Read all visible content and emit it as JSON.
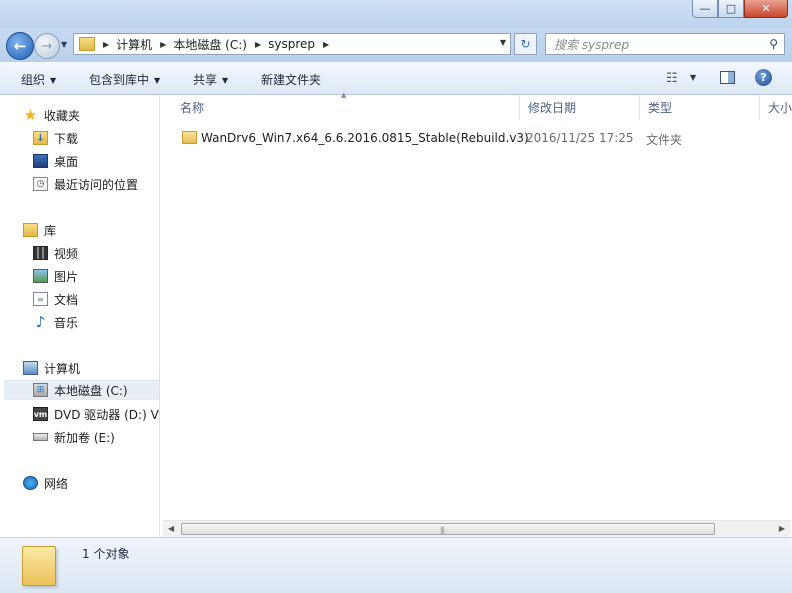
{
  "window": {
    "caption_buttons": {
      "minimize": "—",
      "maximize": "□",
      "close": "✕"
    }
  },
  "navigation": {
    "back": "←",
    "forward": "→",
    "history_arrow": "▼",
    "breadcrumbs": [
      "计算机",
      "本地磁盘 (C:)",
      "sysprep"
    ],
    "address_dropdown": "▼",
    "refresh": "↻",
    "search_placeholder": "搜索 sysprep"
  },
  "commandbar": {
    "organize": "组织",
    "include_in_library": "包含到库中",
    "share": "共享",
    "new_folder": "新建文件夹",
    "dropdown_arrow": "▼",
    "help": "?"
  },
  "navpane": {
    "favorites": {
      "label": "收藏夹",
      "items": [
        "下载",
        "桌面",
        "最近访问的位置"
      ]
    },
    "libraries": {
      "label": "库",
      "items": [
        "视频",
        "图片",
        "文档",
        "音乐"
      ]
    },
    "computer": {
      "label": "计算机",
      "items": [
        "本地磁盘 (C:)",
        "DVD 驱动器 (D:) VM",
        "新加卷 (E:)"
      ]
    },
    "network": {
      "label": "网络"
    }
  },
  "filelist": {
    "columns": [
      "名称",
      "修改日期",
      "类型",
      "大小"
    ],
    "rows": [
      {
        "name": "WanDrv6_Win7.x64_6.6.2016.0815_Stable(Rebuild.v3)",
        "modified": "2016/11/25 17:25",
        "type": "文件夹"
      }
    ]
  },
  "scrollbar": {
    "left_arrow": "◀",
    "right_arrow": "▶",
    "grip": "|||"
  },
  "details": {
    "status": "1 个对象"
  },
  "colors": {
    "selection": "#e8eef6",
    "header_text": "#4d6185",
    "accent": "#1f5fb4"
  },
  "icons": [
    "star-icon",
    "download-folder-icon",
    "desktop-icon",
    "recent-places-icon",
    "library-icon",
    "video-icon",
    "picture-icon",
    "document-icon",
    "music-icon",
    "computer-icon",
    "drive-c-icon",
    "dvd-drive-icon",
    "drive-e-icon",
    "network-icon",
    "folder-icon",
    "search-icon",
    "help-icon"
  ]
}
